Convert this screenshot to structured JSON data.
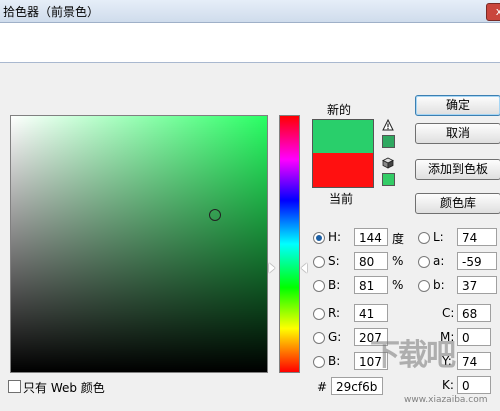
{
  "window": {
    "title": "拾色器（前景色）",
    "close_label": "x"
  },
  "swatches": {
    "new_label": "新的",
    "current_label": "当前",
    "new_color": "#29cf6b",
    "current_color": "#ff1010"
  },
  "buttons": {
    "ok": "确定",
    "cancel": "取消",
    "add_swatch": "添加到色板",
    "libraries": "颜色库"
  },
  "hsb": {
    "h": {
      "label": "H:",
      "value": "144",
      "unit": "度"
    },
    "s": {
      "label": "S:",
      "value": "80",
      "unit": "%"
    },
    "b": {
      "label": "B:",
      "value": "81",
      "unit": "%"
    }
  },
  "rgb": {
    "r": {
      "label": "R:",
      "value": "41"
    },
    "g": {
      "label": "G:",
      "value": "207"
    },
    "b": {
      "label": "B:",
      "value": "107"
    }
  },
  "lab": {
    "l": {
      "label": "L:",
      "value": "74"
    },
    "a": {
      "label": "a:",
      "value": "-59"
    },
    "b": {
      "label": "b:",
      "value": "37"
    }
  },
  "cmyk": {
    "c": {
      "label": "C:",
      "value": "68"
    },
    "m": {
      "label": "M:",
      "value": "0"
    },
    "y": {
      "label": "Y:",
      "value": "74"
    },
    "k": {
      "label": "K:",
      "value": "0"
    }
  },
  "hex": {
    "label": "#",
    "value": "29cf6b"
  },
  "web_only": {
    "label": "只有 Web 颜色"
  },
  "watermark": {
    "text": "下载吧",
    "url": "www.xiazaiba.com"
  }
}
